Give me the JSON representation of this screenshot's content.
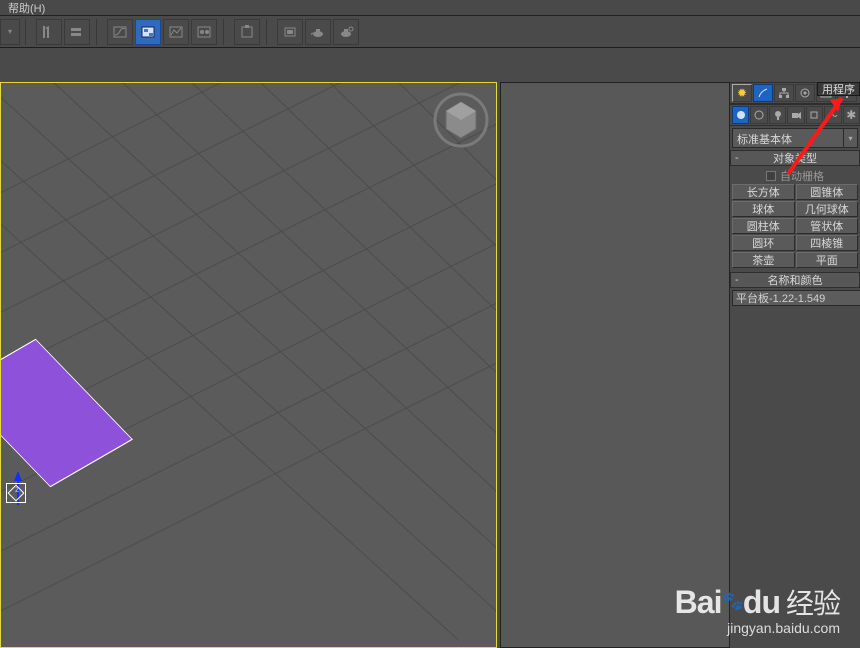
{
  "menu": {
    "help": "帮助(H)"
  },
  "object_type": {
    "header": "对象类型",
    "auto_grid": "自动栅格"
  },
  "dropdown_label": "标准基本体",
  "tooltip": "用程序",
  "primitives": {
    "box": "长方体",
    "cone": "圆锥体",
    "sphere": "球体",
    "geosphere": "几何球体",
    "cylinder": "圆柱体",
    "tube": "管状体",
    "torus": "圆环",
    "pyramid": "四棱锥",
    "teapot": "茶壶",
    "plane": "平面"
  },
  "name_and_color": {
    "header": "名称和颜色",
    "value": "平台板-1.22-1.549"
  },
  "watermark": {
    "brand": "Baidu",
    "cn": "经验",
    "url": "jingyan.baidu.com"
  }
}
